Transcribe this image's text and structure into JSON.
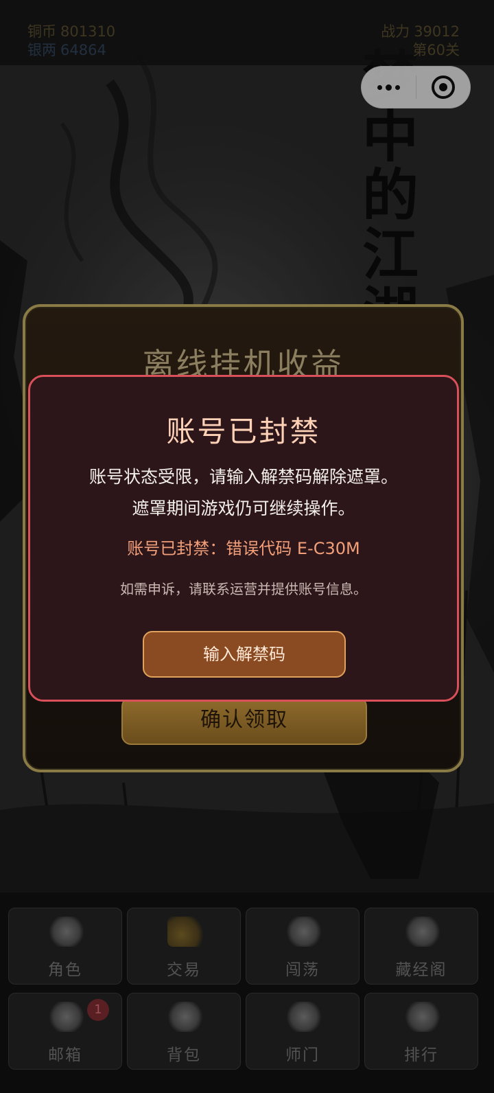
{
  "background": {
    "calligraphy": [
      "梦",
      "中",
      "的",
      "江",
      "湖"
    ]
  },
  "status": {
    "copper_label": "铜币",
    "copper_value": "801310",
    "silver_label": "银两",
    "silver_value": "64864",
    "power_label": "战力",
    "power_value": "39012",
    "stage": "第60关"
  },
  "reward_panel": {
    "title": "离线挂机收益",
    "claim_label": "确认领取"
  },
  "ban_dialog": {
    "title": "账号已封禁",
    "line1": "账号状态受限，请输入解禁码解除遮罩。",
    "line2": "遮罩期间游戏仍可继续操作。",
    "error_line": "账号已封禁：错误代码 E-C30M",
    "note": "如需申诉，请联系运营并提供账号信息。",
    "button_label": "输入解禁码",
    "accent_color": "#d9505a"
  },
  "menu": [
    {
      "label": "角色",
      "icon": "character-icon"
    },
    {
      "label": "交易",
      "icon": "trade-icon"
    },
    {
      "label": "闯荡",
      "icon": "adventure-icon"
    },
    {
      "label": "藏经阁",
      "icon": "scripture-icon"
    },
    {
      "label": "邮箱",
      "icon": "mail-icon",
      "badge": "1"
    },
    {
      "label": "背包",
      "icon": "backpack-icon"
    },
    {
      "label": "师门",
      "icon": "sect-icon"
    },
    {
      "label": "排行",
      "icon": "ranking-icon"
    }
  ]
}
